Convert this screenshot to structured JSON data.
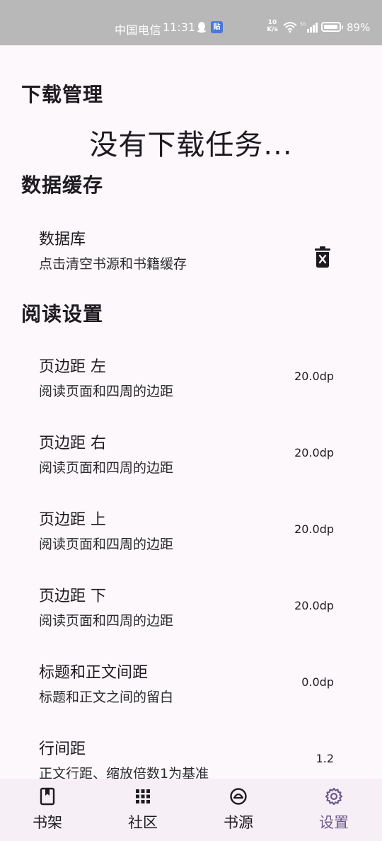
{
  "status_bar": {
    "carrier": "中国电信",
    "time": "11:31",
    "app_badge": "贴",
    "speed_value": "10",
    "speed_unit": "K/s",
    "battery": "89%"
  },
  "download": {
    "title": "下载管理",
    "empty_message": "没有下载任务..."
  },
  "cache": {
    "title": "数据缓存",
    "database": {
      "title": "数据库",
      "subtitle": "点击清空书源和书籍缓存",
      "icon": "trash-icon"
    }
  },
  "reading": {
    "title": "阅读设置",
    "items": [
      {
        "title": "页边距 左",
        "subtitle": "阅读页面和四周的边距",
        "value": "20.0dp"
      },
      {
        "title": "页边距 右",
        "subtitle": "阅读页面和四周的边距",
        "value": "20.0dp"
      },
      {
        "title": "页边距 上",
        "subtitle": "阅读页面和四周的边距",
        "value": "20.0dp"
      },
      {
        "title": "页边距 下",
        "subtitle": "阅读页面和四周的边距",
        "value": "20.0dp"
      },
      {
        "title": "标题和正文间距",
        "subtitle": "标题和正文之间的留白",
        "value": "0.0dp"
      },
      {
        "title": "行间距",
        "subtitle": "正文行距、缩放倍数1为基准",
        "value": "1.2"
      }
    ]
  },
  "bottom_nav": [
    {
      "label": "书架",
      "icon": "bookshelf-icon",
      "active": false
    },
    {
      "label": "社区",
      "icon": "grid-icon",
      "active": false
    },
    {
      "label": "书源",
      "icon": "source-icon",
      "active": false
    },
    {
      "label": "设置",
      "icon": "gear-icon",
      "active": true
    }
  ],
  "colors": {
    "background": "#fdf8fc",
    "status_bar": "#b8b8b8",
    "active_nav": "#6a5b8e",
    "text": "#1d1b20"
  }
}
